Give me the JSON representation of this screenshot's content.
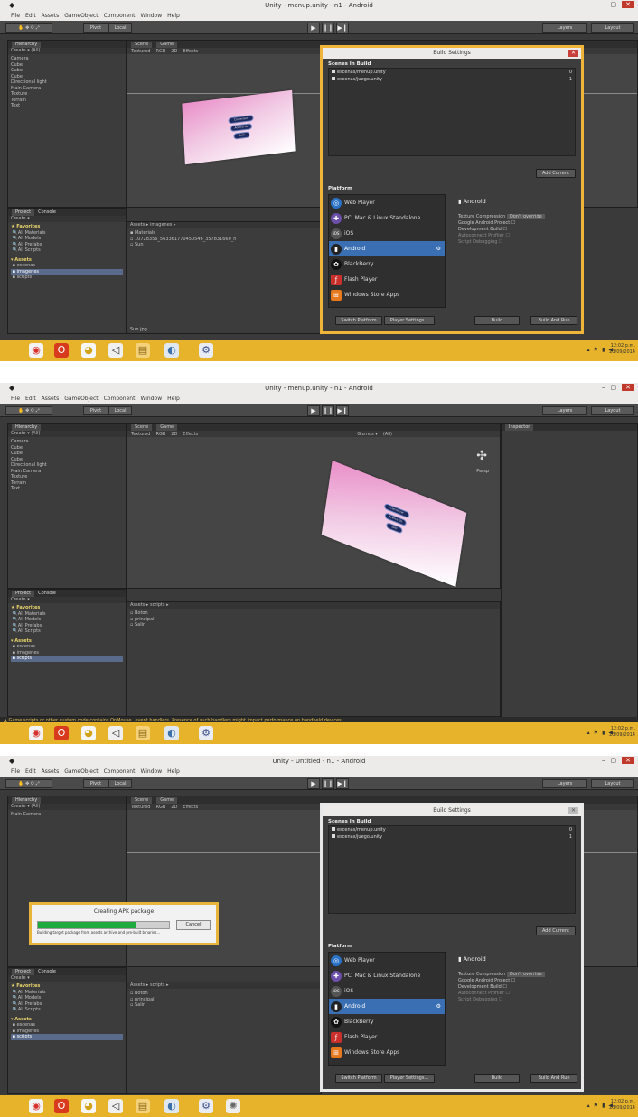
{
  "menu": [
    "File",
    "Edit",
    "Assets",
    "GameObject",
    "Component",
    "Window",
    "Help"
  ],
  "window_buttons": {
    "minimize": "–",
    "maximize": "▢",
    "close": "✕"
  },
  "toolbar": {
    "pivot": "Pivot",
    "local": "Local",
    "layers": "Layers",
    "layout": "Layout",
    "play": "▶",
    "pause": "❙❙",
    "step": "▶❙"
  },
  "hierarchy": {
    "tab": "Hierarchy",
    "create": "Create ▾",
    "search": "(All)",
    "items": [
      "Camera",
      "Cube",
      "Cube",
      "Cube",
      "Directional light",
      "Main Camera",
      "Texture",
      "Terrain",
      "Text"
    ]
  },
  "hierarchy_untitled": {
    "items": [
      "Main Camera"
    ]
  },
  "scene": {
    "tab_scene": "Scene",
    "tab_game": "Game",
    "shading": "Textured",
    "mode": "RGB",
    "mode2": "2D",
    "effects": "Effects",
    "gizmos": "Gizmos ▾",
    "search": "(All)",
    "persp": "Persp"
  },
  "menu_buttons": [
    "Comenzar",
    "Acerca de",
    "Salir"
  ],
  "project": {
    "tab_project": "Project",
    "tab_console": "Console",
    "create": "Create ▾",
    "favorites": "Favorites",
    "fav_items": [
      "All Materials",
      "All Models",
      "All Prefabs",
      "All Scripts"
    ],
    "assets": "Assets",
    "asset_folders": [
      "escenas",
      "imagenes",
      "scripts"
    ]
  },
  "project_view1": {
    "breadcrumb": "Assets ▸ imagenes ▸",
    "items": [
      "Materials",
      "10728356_563361770450546_357831660_n",
      "Sun"
    ],
    "footer": "Sun.jpg"
  },
  "project_view2": {
    "breadcrumb": "Assets ▸ scripts ▸",
    "items": [
      "Boton",
      "principal",
      "Salir"
    ]
  },
  "inspector": {
    "tab": "Inspector"
  },
  "build": {
    "title": "Build Settings",
    "scenes_label": "Scenes In Build",
    "scenes": [
      {
        "name": "escenas/menup.unity",
        "index": "0"
      },
      {
        "name": "escenas/juego.unity",
        "index": "1"
      }
    ],
    "add_current": "Add Current",
    "platform_label": "Platform",
    "platforms": [
      "Web Player",
      "PC, Mac & Linux Standalone",
      "iOS",
      "Android",
      "BlackBerry",
      "Flash Player",
      "Windows Store Apps"
    ],
    "platform_icons": [
      "◎",
      "✚",
      "iOS",
      "▮",
      "✿",
      "ƒ",
      "⊞"
    ],
    "selected": "Android",
    "tex_label": "Texture Compression",
    "tex_value": "Don't override",
    "options": [
      "Google Android Project",
      "Development Build",
      "Autoconnect Profiler",
      "Script Debugging"
    ],
    "switch_platform": "Switch Platform",
    "player_settings": "Player Settings...",
    "build": "Build",
    "build_and_run": "Build And Run"
  },
  "screens": [
    {
      "title": "Unity - menup.unity - n1 - Android"
    },
    {
      "title": "Unity - menup.unity - n1 - Android"
    },
    {
      "title": "Unity - Untitled - n1 - Android"
    }
  ],
  "warning": "Game scripts or other custom code contains OnMouse_ event handlers. Presence of such handlers might impact performance on handheld devices.",
  "apk": {
    "title": "Creating APK package",
    "cancel": "Cancel",
    "message": "Building target package from assets archive and pre-built binaries...",
    "progress": 0.75
  },
  "clock": {
    "time": "12:02 p.m.",
    "date": "23/09/2014"
  },
  "colors": {
    "taskbar": "#e7b32a",
    "highlight": "#3a70b3",
    "dialog_border_1": "#f0b43a",
    "dialog_border_3": "#e8e8e8",
    "progress": "#1faa3e"
  }
}
